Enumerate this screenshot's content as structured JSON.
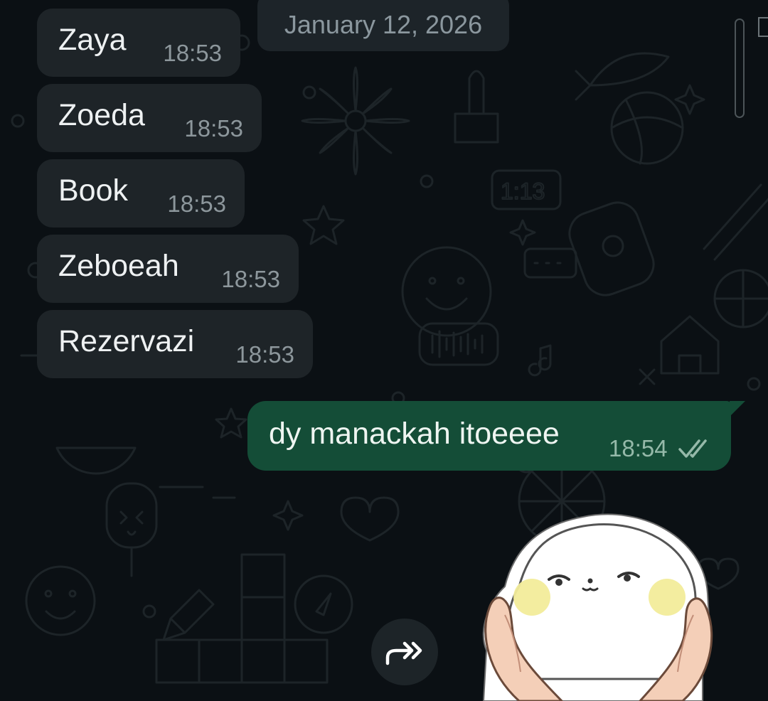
{
  "chat": {
    "date_divider": "January 12, 2026",
    "incoming_messages": [
      {
        "text": "Zaya",
        "time": "18:53"
      },
      {
        "text": "Zoeda",
        "time": "18:53"
      },
      {
        "text": "Book",
        "time": "18:53"
      },
      {
        "text": "Zeboeah",
        "time": "18:53"
      },
      {
        "text": "Rezervazi",
        "time": "18:53"
      }
    ],
    "outgoing_message": {
      "text": "dy manackah itoeeee",
      "time": "18:54",
      "status": "read"
    },
    "sticker": {
      "description_icon": "white-seal-sticker"
    }
  },
  "icons": {
    "read_receipt": "double-check-icon",
    "forward": "forward-icon"
  },
  "colors": {
    "background": "#0b1014",
    "incoming_bubble": "#1e2428",
    "outgoing_bubble": "#144d37",
    "timestamp_in": "#8d979c",
    "timestamp_out": "#95b9a9"
  }
}
